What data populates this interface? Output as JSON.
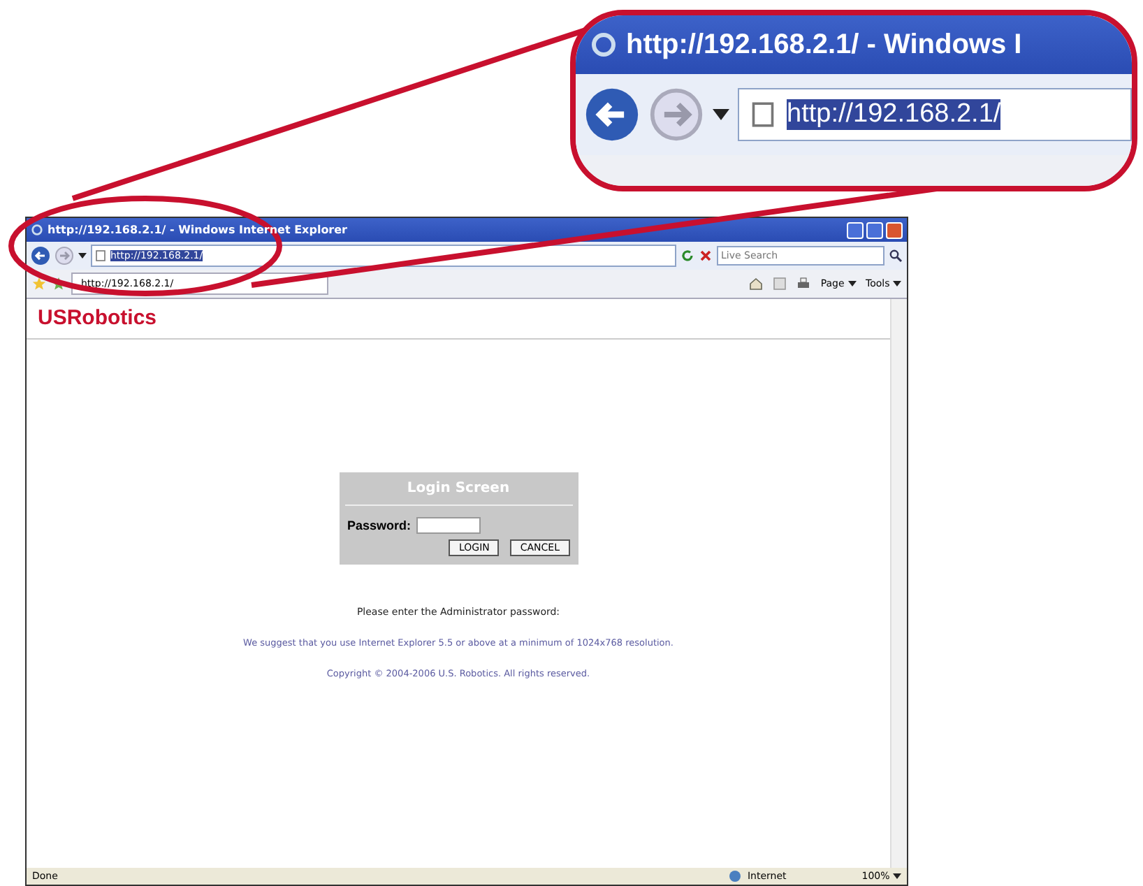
{
  "callout": {
    "title": "http://192.168.2.1/ - Windows I",
    "address": "http://192.168.2.1/"
  },
  "window": {
    "title": "http://192.168.2.1/ - Windows Internet Explorer"
  },
  "address_bar": {
    "value": "http://192.168.2.1/",
    "selected": true
  },
  "search": {
    "placeholder": "Live Search"
  },
  "tabs": [
    {
      "label": "http://192.168.2.1/",
      "selected": true
    }
  ],
  "toolbar": [
    {
      "kind": "home"
    },
    {
      "kind": "feeds"
    },
    {
      "kind": "print"
    },
    {
      "kind": "menu",
      "label": "Page"
    },
    {
      "kind": "menu",
      "label": "Tools"
    }
  ],
  "page": {
    "logo": "USRobotics",
    "login_box": {
      "title": "Login Screen",
      "password_label": "Password:",
      "buttons": [
        "LOGIN",
        "CANCEL"
      ]
    },
    "prompt": "Please enter the Administrator password:",
    "notice": "We suggest that you use Internet Explorer 5.5 or above at a minimum of 1024x768 resolution.",
    "copyright": "Copyright © 2004-2006 U.S. Robotics. All rights reserved."
  },
  "status_bar": {
    "status": "Done",
    "zone": "Internet",
    "zoom": "100%"
  }
}
